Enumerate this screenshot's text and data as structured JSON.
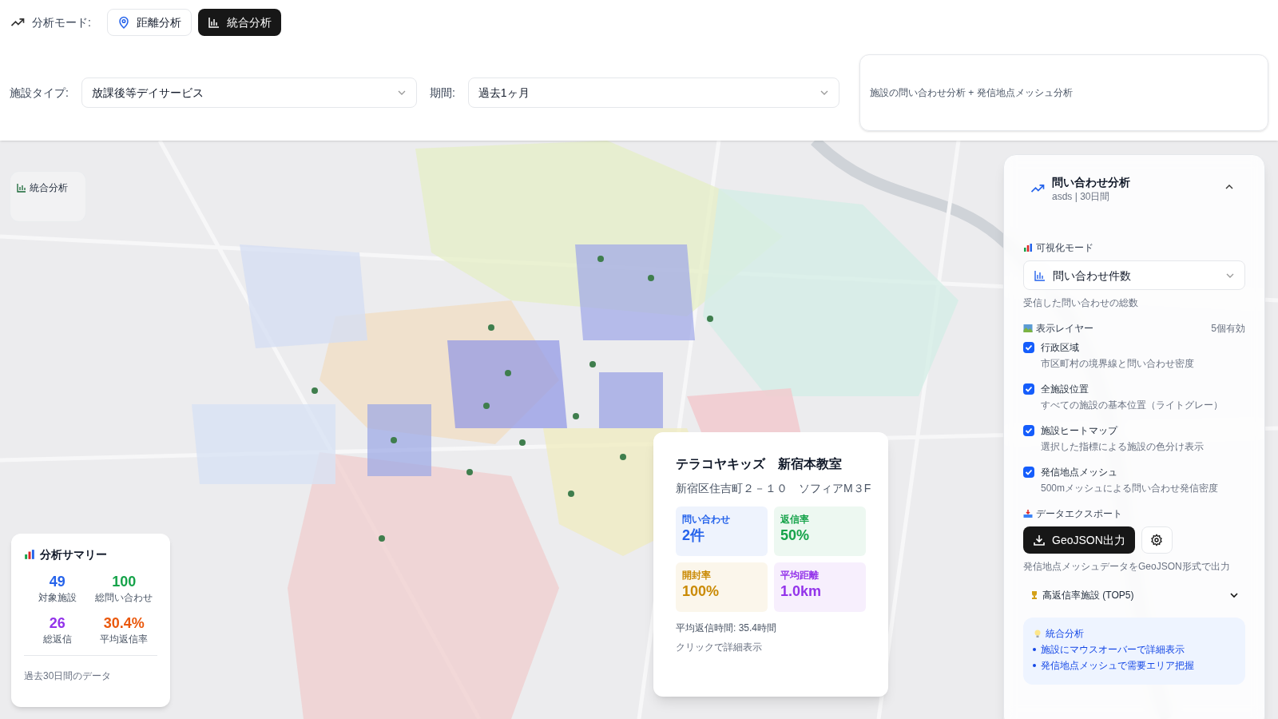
{
  "mode": {
    "label": "分析モード:",
    "options": [
      {
        "label": "距離分析",
        "kind": "pin",
        "selected": false
      },
      {
        "label": "統合分析",
        "kind": "chart",
        "selected": true
      }
    ]
  },
  "filters": [
    {
      "label": "施設タイプ:",
      "value": "放課後等デイサービス"
    },
    {
      "label": "期間:",
      "value": "過去1ヶ月"
    }
  ],
  "description": "施設の問い合わせ分析 + 発信地点メッシュ分析",
  "map_badge": "統合分析",
  "tooltip": {
    "title": "テラコヤキッズ　新宿本教室",
    "address": "新宿区住吉町２－１０　ソフィアM３F",
    "stats": [
      {
        "label": "問い合わせ",
        "value": "2件",
        "color": "#2563eb"
      },
      {
        "label": "返信率",
        "value": "50%",
        "color": "#16a34a"
      },
      {
        "label": "開封率",
        "value": "100%",
        "color": "#ca8a04"
      },
      {
        "label": "平均距離",
        "value": "1.0km",
        "color": "#9333ea"
      }
    ],
    "avg_reply": "平均返信時間: 35.4時間",
    "hint": "クリックで詳細表示"
  },
  "summary": {
    "title": "分析サマリー",
    "stats": [
      {
        "value": "49",
        "label": "対象施設",
        "color": "#2563eb"
      },
      {
        "value": "100",
        "label": "総問い合わせ",
        "color": "#16a34a"
      },
      {
        "value": "26",
        "label": "総返信",
        "color": "#9333ea"
      },
      {
        "value": "30.4%",
        "label": "平均返信率",
        "color": "#ea580c"
      }
    ],
    "footer": "過去30日間のデータ"
  },
  "panel": {
    "title": "問い合わせ分析",
    "subtitle": "asds | 30日間",
    "expanded": true,
    "viz_label": "可視化モード",
    "viz_select": "問い合わせ件数",
    "viz_desc": "受信した問い合わせの総数",
    "layers_label": "表示レイヤー",
    "layers_count": "5個有効",
    "layers": [
      {
        "label": "行政区域",
        "desc": "市区町村の境界線と問い合わせ密度",
        "checked": true
      },
      {
        "label": "全施設位置",
        "desc": "すべての施設の基本位置（ライトグレー）",
        "checked": true
      },
      {
        "label": "施設ヒートマップ",
        "desc": "選択した指標による施設の色分け表示",
        "checked": true
      },
      {
        "label": "発信地点メッシュ",
        "desc": "500mメッシュによる問い合わせ発信密度",
        "checked": true
      }
    ],
    "export_label": "データエクスポート",
    "export_button": "GeoJSON出力",
    "export_desc": "発信地点メッシュデータをGeoJSON形式で出力",
    "top5": {
      "label": "高返信率施設 (TOP5)",
      "expanded": false
    },
    "tips": {
      "title": "統合分析",
      "items": [
        "施設にマウスオーバーで詳細表示",
        "発信地点メッシュで需要エリア把握"
      ]
    }
  }
}
